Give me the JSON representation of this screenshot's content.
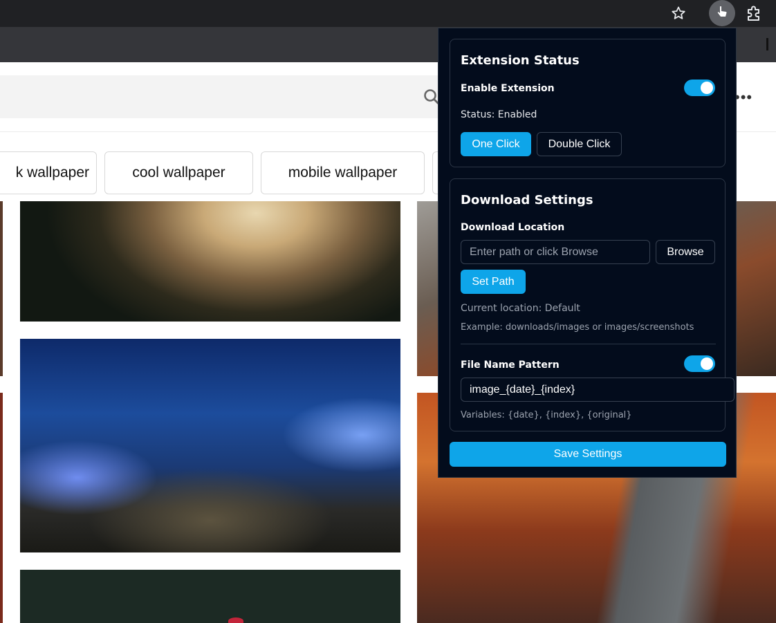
{
  "browser": {
    "icons": [
      "star-icon",
      "pointer-icon",
      "puzzle-icon"
    ]
  },
  "page": {
    "chips": [
      "k wallpaper",
      "cool wallpaper",
      "mobile wallpaper"
    ],
    "icons": [
      "search-icon",
      "more-icon"
    ],
    "more_glyph": "•••"
  },
  "popup": {
    "extension_status": {
      "title": "Extension Status",
      "enable_label": "Enable Extension",
      "enable_on": true,
      "status_text": "Status: Enabled",
      "click_modes": [
        "One Click",
        "Double Click"
      ],
      "selected_mode": "One Click"
    },
    "download_settings": {
      "title": "Download Settings",
      "location_label": "Download Location",
      "path_placeholder": "Enter path or click Browse",
      "browse_label": "Browse",
      "set_path_label": "Set Path",
      "current_location": "Current location: Default",
      "example": "Example: downloads/images or images/screenshots",
      "pattern_label": "File Name Pattern",
      "pattern_on": true,
      "pattern_value": "image_{date}_{index}",
      "variables": "Variables: {date}, {index}, {original}"
    },
    "save_label": "Save Settings"
  },
  "colors": {
    "accent": "#0ea5e9",
    "popup_bg": "#030c1c",
    "chrome_bg": "#202124"
  }
}
